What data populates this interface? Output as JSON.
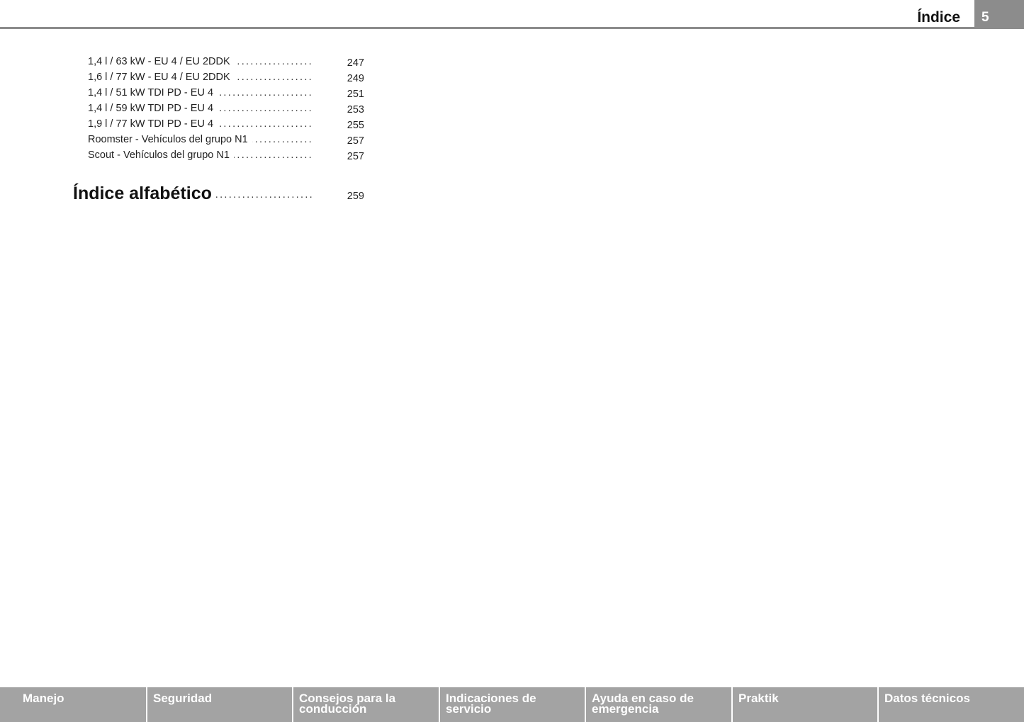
{
  "header": {
    "section_title": "Índice",
    "page_number": "5"
  },
  "toc": {
    "items": [
      {
        "label": "1,4 l / 63 kW - EU 4 / EU 2DDK",
        "page": "247"
      },
      {
        "label": "1,6 l / 77 kW - EU 4 / EU 2DDK",
        "page": "249"
      },
      {
        "label": "1,4 l / 51 kW TDI PD - EU 4",
        "page": "251"
      },
      {
        "label": "1,4 l / 59 kW TDI PD - EU 4",
        "page": "253"
      },
      {
        "label": "1,9 l / 77 kW TDI PD - EU 4",
        "page": "255"
      },
      {
        "label": "Roomster - Vehículos del grupo N1",
        "page": "257"
      },
      {
        "label": "Scout - Vehículos del grupo N1",
        "page": "257"
      }
    ],
    "main_entry": {
      "label": "Índice alfabético",
      "page": "259"
    }
  },
  "footer": {
    "tabs": [
      {
        "label": "Manejo"
      },
      {
        "label": "Seguridad"
      },
      {
        "label": "Consejos para la conducción"
      },
      {
        "label": "Indicaciones de servicio"
      },
      {
        "label": "Ayuda en caso de emergencia"
      },
      {
        "label": "Praktik"
      },
      {
        "label": "Datos técnicos"
      }
    ]
  },
  "colors": {
    "header_gray": "#8c8c8c",
    "tab_gray": "#a3a3a3",
    "text": "#1a1a1a"
  }
}
